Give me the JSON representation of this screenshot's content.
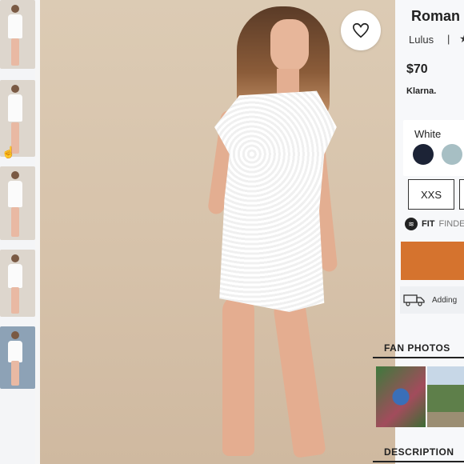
{
  "product": {
    "title": "Roman",
    "brand": "Lulus",
    "brand_separator": "|",
    "price": "$70",
    "payment_label": "Klarna."
  },
  "color": {
    "label": "White",
    "swatches": [
      {
        "name": "navy",
        "hex": "#1c2336"
      },
      {
        "name": "light-blue",
        "hex": "#a7bfc4"
      }
    ]
  },
  "sizes": [
    "XXS"
  ],
  "fit_finder": {
    "bold": "FIT",
    "rest": "FINDE"
  },
  "shipping_text": "Adding",
  "sections": {
    "fan_photos": "FAN PHOTOS",
    "description": "DESCRIPTION"
  },
  "colors": {
    "accent": "#d5732e",
    "panel_bg": "#f7f8fa",
    "photo_bg": "#d8c6ae"
  },
  "icons": {
    "favorite": "heart-outline-icon",
    "rating": "star-icon",
    "fit": "fit-finder-icon",
    "shipping": "truck-icon",
    "cursor": "hand-pointer-icon"
  }
}
